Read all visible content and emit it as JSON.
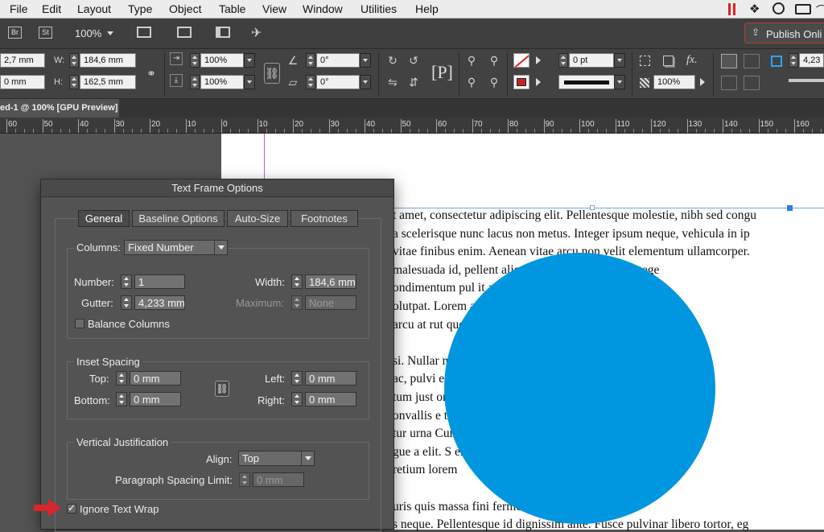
{
  "menubar": {
    "items": [
      "File",
      "Edit",
      "Layout",
      "Type",
      "Object",
      "Table",
      "View",
      "Window",
      "Utilities",
      "Help"
    ]
  },
  "appbar": {
    "br_label": "Br",
    "st_label": "St",
    "zoom": "100%",
    "publish_label": "Publish Onli"
  },
  "control": {
    "x_value": "2,7 mm",
    "y_value": "0 mm",
    "w_label": "W:",
    "h_label": "H:",
    "w_value": "184,6 mm",
    "h_value": "162,5 mm",
    "scale_x": "100%",
    "scale_y": "100%",
    "rotate": "0°",
    "shear": "0°",
    "stroke_weight": "0 pt",
    "opacity": "100%",
    "fx_label": "fx.",
    "frame_value": "4,23"
  },
  "doctab": {
    "label": "ed-1 @ 100% [GPU Preview]"
  },
  "ruler": {
    "labels": [
      "60",
      "50",
      "40",
      "30",
      "20",
      "10",
      "0",
      "10",
      "20",
      "30",
      "40",
      "50",
      "60",
      "70",
      "80",
      "90",
      "100",
      "110",
      "120",
      "130",
      "140",
      "150",
      "160"
    ]
  },
  "document": {
    "lines": [
      "t amet, consectetur adipiscing elit. Pellentesque molestie, nibh sed congu",
      "a scelerisque nunc lacus non metus. Integer ipsum neque, vehicula in ip",
      "vitae finibus enim. Aenean vitae arcu non velit elementum ullamcorper.",
      "malesuada id, pellent                              aliquet vestibulum enim. Intege",
      "ondimentum pul                                  it ante, eget accumsan ex. I",
      "olutpat. Lorem                                   adipiscing elit. Proin se",
      "arcu at rut                                        quet tortor in, rutrum",
      "",
      "si. Nullar                                          ndit felis feugiat. Cr",
      "ac, pulvi                                            ean vitae efficitur ve",
      "tum just                                             orci, nec tincidunt",
      "onvallis e                                          tincidunt nisi, eu",
      "tur urna                                            Curabitur purus tor",
      "gue a elit. S                                      eros auctor lobortis.",
      "retium lorem",
      "",
      "uris quis massa fini                              fermentum diam. Donec eu f",
      "s neque. Pellentesque id dignissim ante. Fusce pulvinar libero tortor, eg"
    ]
  },
  "dialog": {
    "title": "Text Frame Options",
    "tabs": [
      "General",
      "Baseline Options",
      "Auto-Size",
      "Footnotes"
    ],
    "columns": {
      "label": "Columns:",
      "type": "Fixed Number",
      "number_label": "Number:",
      "number_value": "1",
      "width_label": "Width:",
      "width_value": "184,6 mm",
      "gutter_label": "Gutter:",
      "gutter_value": "4,233 mm",
      "maximum_label": "Maximum:",
      "maximum_placeholder": "None",
      "balance_label": "Balance Columns"
    },
    "inset": {
      "title": "Inset Spacing",
      "top_label": "Top:",
      "top_value": "0 mm",
      "bottom_label": "Bottom:",
      "bottom_value": "0 mm",
      "left_label": "Left:",
      "left_value": "0 mm",
      "right_label": "Right:",
      "right_value": "0 mm"
    },
    "vj": {
      "title": "Vertical Justification",
      "align_label": "Align:",
      "align_value": "Top",
      "psl_label": "Paragraph Spacing Limit:",
      "psl_value": "0 mm"
    },
    "ignore_wrap_label": "Ignore Text Wrap",
    "ignore_wrap_checked": true,
    "balance_checked": false
  },
  "colors": {
    "circle": "#0096e0",
    "annotation_arrow": "#d9262a"
  }
}
